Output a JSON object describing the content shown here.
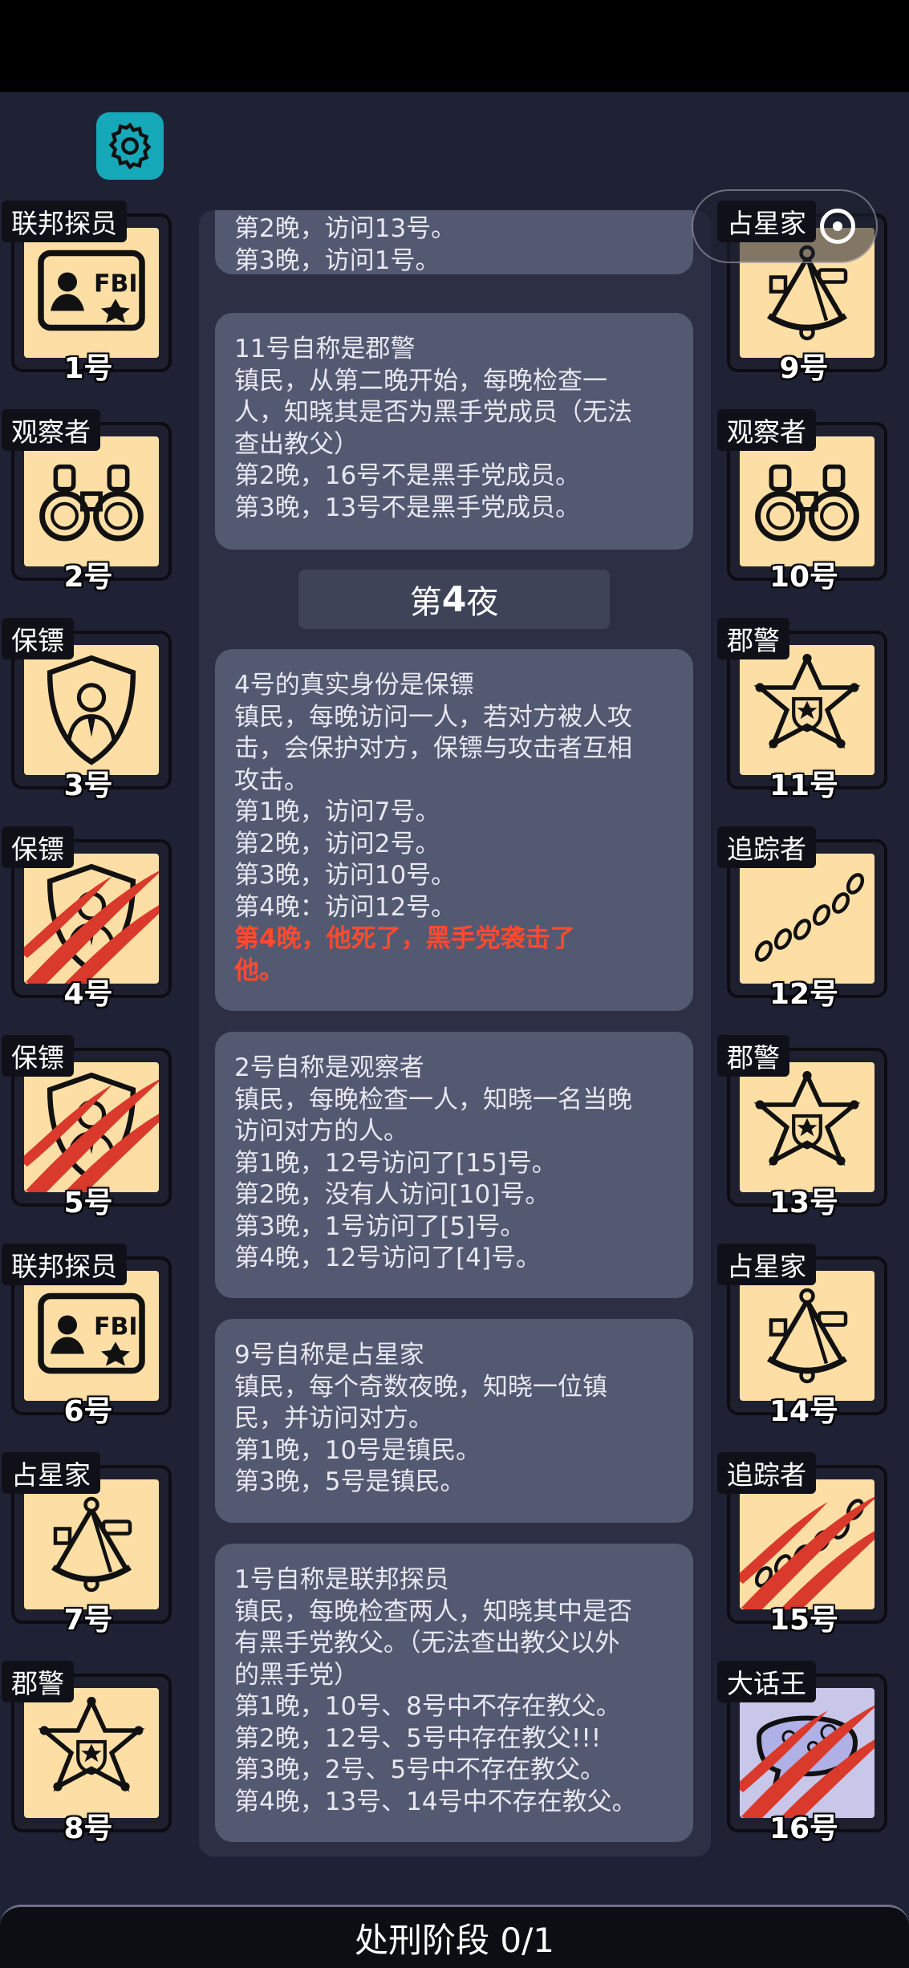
{
  "log": {
    "entry0": [
      "第2晚，访问13号。",
      "第3晚，访问1号。"
    ],
    "entry1": [
      "11号自称是郡警",
      "镇民，从第二晚开始，每晚检查一",
      "人，知晓其是否为黑手党成员（无法",
      "查出教父）",
      "第2晚，16号不是黑手党成员。",
      "第3晚，13号不是黑手党成员。"
    ],
    "night_prefix": "第",
    "night_number": "4",
    "night_suffix": "夜",
    "entry2": [
      "4号的真实身份是保镖",
      "镇民，每晚访问一人，若对方被人攻",
      "击，会保护对方，保镖与攻击者互相",
      "攻击。",
      "第1晚，访问7号。",
      "第2晚，访问2号。",
      "第3晚，访问10号。",
      "第4晚：访问12号。"
    ],
    "entry2_death": [
      "第4晚，他死了，黑手党袭击了",
      "他。"
    ],
    "entry3": [
      "2号自称是观察者",
      "镇民，每晚检查一人，知晓一名当晚",
      "访问对方的人。",
      "第1晚，12号访问了[15]号。",
      "第2晚，没有人访问[10]号。",
      "第3晚，1号访问了[5]号。",
      "第4晚，12号访问了[4]号。"
    ],
    "entry4": [
      "9号自称是占星家",
      "镇民，每个奇数夜晚，知晓一位镇",
      "民，并访问对方。",
      "第1晚，10号是镇民。",
      "第3晚，5号是镇民。"
    ],
    "entry5": [
      "1号自称是联邦探员",
      "镇民，每晚检查两人，知晓其中是否",
      "有黑手党教父。（无法查出教父以外",
      "的黑手党）",
      "第1晚，10号、8号中不存在教父。",
      "第2晚，12号、5号中存在教父!!!",
      "第3晚，2号、5号中不存在教父。",
      "第4晚，13号、14号中不存在教父。"
    ]
  },
  "players": [
    {
      "role": "联邦探员",
      "num": "1号",
      "icon": "fbi-badge-icon",
      "dead": false
    },
    {
      "role": "观察者",
      "num": "2号",
      "icon": "binoculars-icon",
      "dead": false
    },
    {
      "role": "保镖",
      "num": "3号",
      "icon": "bodyguard-shield-icon",
      "dead": false
    },
    {
      "role": "保镖",
      "num": "4号",
      "icon": "bodyguard-shield-icon",
      "dead": true
    },
    {
      "role": "保镖",
      "num": "5号",
      "icon": "bodyguard-shield-icon",
      "dead": true
    },
    {
      "role": "联邦探员",
      "num": "6号",
      "icon": "fbi-badge-icon",
      "dead": false
    },
    {
      "role": "占星家",
      "num": "7号",
      "icon": "sextant-icon",
      "dead": false
    },
    {
      "role": "郡警",
      "num": "8号",
      "icon": "sheriff-star-icon",
      "dead": false
    },
    {
      "role": "占星家",
      "num": "9号",
      "icon": "sextant-icon",
      "dead": false
    },
    {
      "role": "观察者",
      "num": "10号",
      "icon": "binoculars-icon",
      "dead": false
    },
    {
      "role": "郡警",
      "num": "11号",
      "icon": "sheriff-star-icon",
      "dead": false
    },
    {
      "role": "追踪者",
      "num": "12号",
      "icon": "footprints-icon",
      "dead": false
    },
    {
      "role": "郡警",
      "num": "13号",
      "icon": "sheriff-star-icon",
      "dead": false
    },
    {
      "role": "占星家",
      "num": "14号",
      "icon": "sextant-icon",
      "dead": false
    },
    {
      "role": "追踪者",
      "num": "15号",
      "icon": "footprints-icon",
      "dead": true
    },
    {
      "role": "大话王",
      "num": "16号",
      "icon": "liar-bubble-icon",
      "dead": true
    }
  ],
  "bottom": {
    "phase_label": "处刑阶段 0/1"
  },
  "capsule": {
    "more": "•••"
  },
  "colors": {
    "death_text": "#ff4a2e",
    "card_bg": "#fddfa6",
    "liar_card_bg": "#c9c7e9",
    "gear_bg": "#14a8b8",
    "claw": "#d93a2b"
  }
}
